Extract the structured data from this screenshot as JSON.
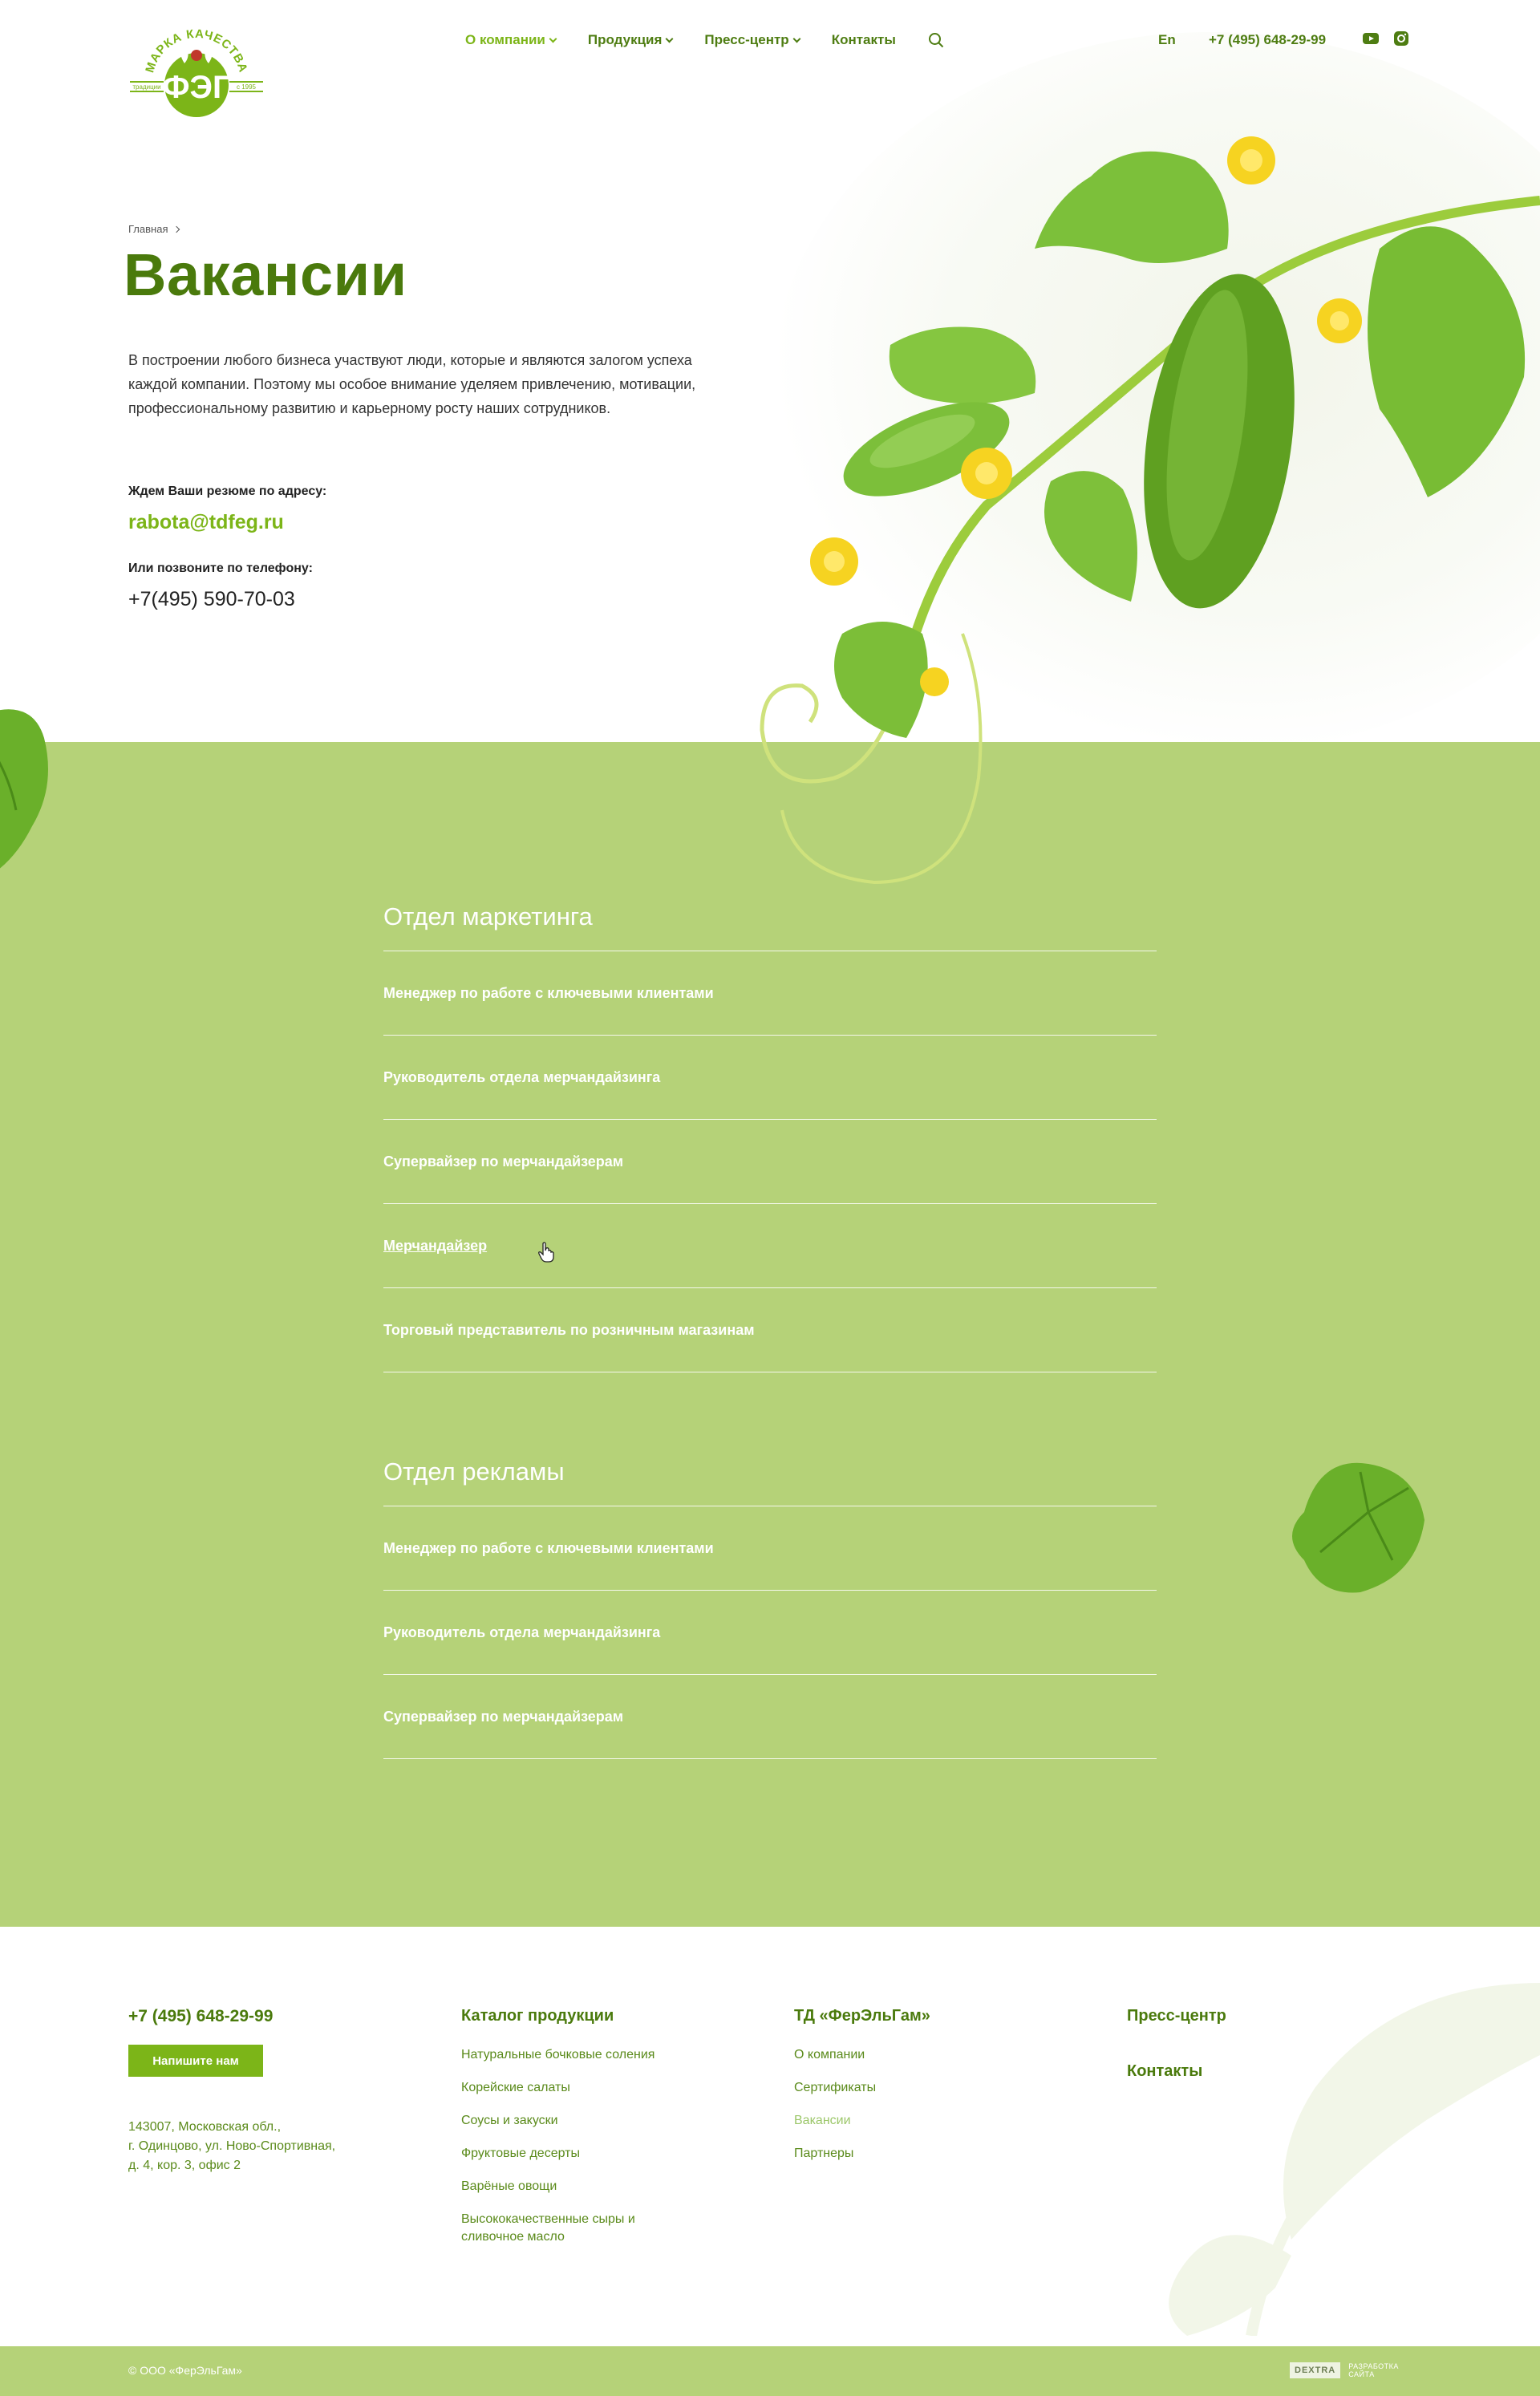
{
  "header": {
    "logo": {
      "text_top": "МАРКА КАЧЕСТВА",
      "text_center": "ФЭГ",
      "text_left": "традиции",
      "text_right": "с 1995"
    },
    "nav": [
      {
        "label": "О компании",
        "has_dropdown": true,
        "active": true
      },
      {
        "label": "Продукция",
        "has_dropdown": true,
        "active": false
      },
      {
        "label": "Пресс-центр",
        "has_dropdown": true,
        "active": false
      },
      {
        "label": "Контакты",
        "has_dropdown": false,
        "active": false
      }
    ],
    "search_icon": "search-icon",
    "language": "En",
    "phone": "+7 (495) 648-29-99",
    "social": [
      "youtube-icon",
      "instagram-icon"
    ]
  },
  "hero": {
    "breadcrumb": [
      "Главная"
    ],
    "title": "Вакансии",
    "intro": "В построении любого бизнеса участвуют люди, которые и являются залогом успеха каждой компании. Поэтому мы особое внимание уделяем привлечению, мотивации, профессиональному развитию и карьерному росту наших сотрудников.",
    "resume_label": "Ждем Ваши резюме по адресу:",
    "resume_email": "rabota@tdfeg.ru",
    "call_label": "Или позвоните по телефону:",
    "call_phone": "+7(495) 590-70-03"
  },
  "departments": [
    {
      "title": "Отдел маркетинга",
      "vacancies": [
        "Менеджер по работе с ключевыми клиентами",
        "Руководитель отдела мерчандайзинга",
        "Супервайзер по мерчандайзерам",
        "Мерчандайзер",
        "Торговый представитель по розничным магазинам"
      ]
    },
    {
      "title": "Отдел рекламы",
      "vacancies": [
        "Менеджер по работе с ключевыми клиентами",
        "Руководитель отдела мерчандайзинга",
        "Супервайзер по мерчандайзерам"
      ]
    }
  ],
  "footer": {
    "phone": "+7 (495) 648-29-99",
    "write_button": "Напишите нам",
    "address_lines": [
      "143007, Московская обл.,",
      "г. Одинцово, ул. Ново-Спортивная,",
      "д. 4, кор. 3, офис 2"
    ],
    "catalog": {
      "title": "Каталог продукции",
      "links": [
        "Натуральные бочковые соления",
        "Корейские салаты",
        "Соусы и закуски",
        "Фруктовые десерты",
        "Варёные овощи",
        "Высококачественные сыры и сливочное масло"
      ]
    },
    "company": {
      "title": "ТД «ФерЭльГам»",
      "links": [
        "О компании",
        "Сертификаты",
        "Вакансии",
        "Партнеры"
      ],
      "active_index": 2
    },
    "press": "Пресс-центр",
    "contacts": "Контакты",
    "copyright": "© ООО «ФерЭльГам»",
    "developer": {
      "badge": "DEXTRA",
      "line1": "РАЗРАБОТКА",
      "line2": "САЙТА"
    }
  },
  "colors": {
    "brand_green": "#7cb518",
    "dark_green": "#4a7a0c",
    "section_bg": "#b5d278",
    "white": "#ffffff"
  }
}
